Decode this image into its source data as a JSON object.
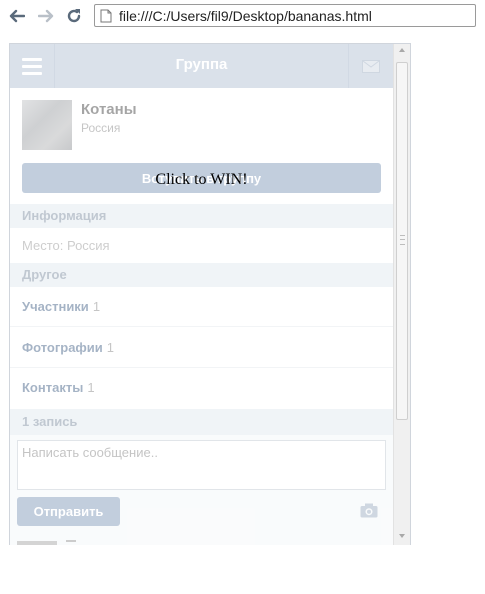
{
  "browser": {
    "url": "file:///C:/Users/fil9/Desktop/bananas.html"
  },
  "header": {
    "title": "Группа"
  },
  "group": {
    "name": "Котаны",
    "country": "Россия"
  },
  "join_button": "Вступить в группу",
  "overlay_text": "Click to WIN!",
  "sections": {
    "info": "Информация",
    "place": "Место: Россия",
    "other": "Другое",
    "posts": "1 запись"
  },
  "rows": [
    {
      "label": "Участники",
      "count": "1"
    },
    {
      "label": "Фотографии",
      "count": "1"
    },
    {
      "label": "Контакты",
      "count": "1"
    }
  ],
  "composer": {
    "placeholder": "Написать сообщение..",
    "send_label": "Отправить"
  }
}
